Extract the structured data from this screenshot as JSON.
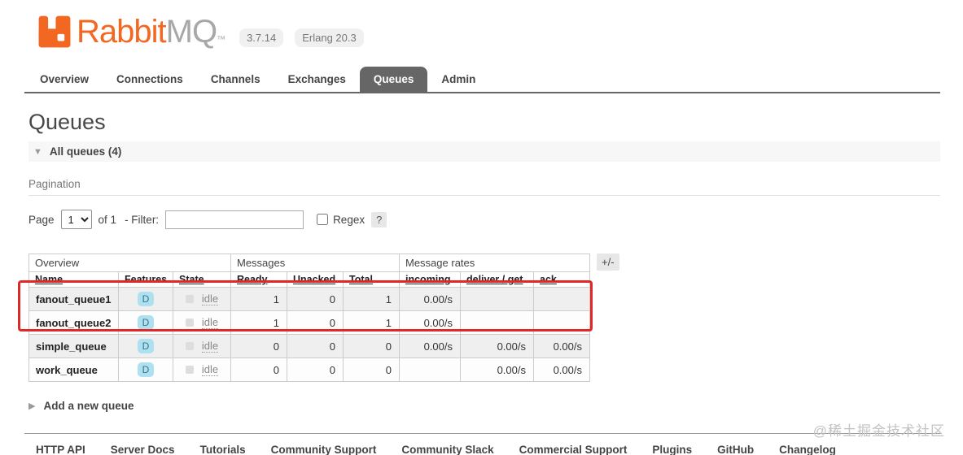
{
  "header": {
    "logo_text_primary": "Rabbit",
    "logo_text_secondary": "MQ",
    "logo_tm": "™",
    "version_badge": "3.7.14",
    "erlang_badge": "Erlang 20.3"
  },
  "nav": {
    "tabs": [
      {
        "label": "Overview",
        "selected": false
      },
      {
        "label": "Connections",
        "selected": false
      },
      {
        "label": "Channels",
        "selected": false
      },
      {
        "label": "Exchanges",
        "selected": false
      },
      {
        "label": "Queues",
        "selected": true
      },
      {
        "label": "Admin",
        "selected": false
      }
    ]
  },
  "main": {
    "page_title": "Queues",
    "all_queues_section": {
      "collapse_icon": "▼",
      "label": "All queues (4)"
    },
    "pagination": {
      "heading": "Pagination",
      "page_label": "Page",
      "page_value": "1",
      "of_label": "of 1",
      "filter_label": "- Filter:",
      "filter_value": "",
      "regex_label": "Regex",
      "help_label": "?"
    },
    "table": {
      "group_headers": [
        "Overview",
        "Messages",
        "Message rates"
      ],
      "columns": {
        "name": "Name",
        "features": "Features",
        "state": "State",
        "ready": "Ready",
        "unacked": "Unacked",
        "total": "Total",
        "incoming": "incoming",
        "deliver_get": "deliver / get",
        "ack": "ack"
      },
      "column_toggle_label": "+/-",
      "rows": [
        {
          "name": "fanout_queue1",
          "features": "D",
          "state": "idle",
          "ready": "1",
          "unacked": "0",
          "total": "1",
          "incoming": "0.00/s",
          "deliver_get": "",
          "ack": ""
        },
        {
          "name": "fanout_queue2",
          "features": "D",
          "state": "idle",
          "ready": "1",
          "unacked": "0",
          "total": "1",
          "incoming": "0.00/s",
          "deliver_get": "",
          "ack": ""
        },
        {
          "name": "simple_queue",
          "features": "D",
          "state": "idle",
          "ready": "0",
          "unacked": "0",
          "total": "0",
          "incoming": "0.00/s",
          "deliver_get": "0.00/s",
          "ack": "0.00/s"
        },
        {
          "name": "work_queue",
          "features": "D",
          "state": "idle",
          "ready": "0",
          "unacked": "0",
          "total": "0",
          "incoming": "",
          "deliver_get": "0.00/s",
          "ack": "0.00/s"
        }
      ]
    },
    "add_queue": {
      "collapse_icon": "▶",
      "label": "Add a new queue"
    }
  },
  "footer": {
    "links": [
      "HTTP API",
      "Server Docs",
      "Tutorials",
      "Community Support",
      "Community Slack",
      "Commercial Support",
      "Plugins",
      "GitHub",
      "Changelog"
    ]
  },
  "watermark": "@稀土掘金技术社区",
  "colors": {
    "brand_orange": "#f26822",
    "tab_selected_bg": "#666666",
    "feature_badge_bg": "#ade1f2",
    "annotation_red": "#e12829",
    "row_alt_bg": "#efefef"
  }
}
